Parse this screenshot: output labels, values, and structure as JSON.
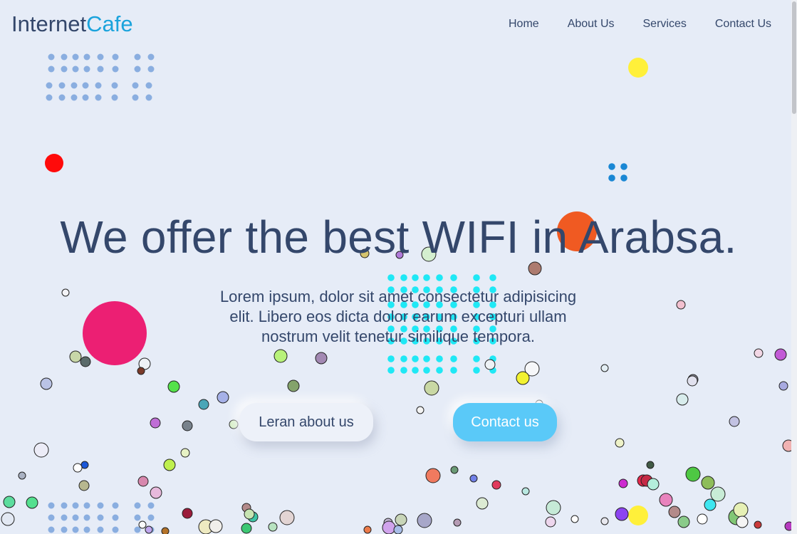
{
  "brand": {
    "part1": "Internet",
    "part2": "Cafe"
  },
  "nav": {
    "items": [
      "Home",
      "About Us",
      "Services",
      "Contact Us"
    ]
  },
  "hero": {
    "title": "We offer the best WIFI in Arabsa.",
    "text": "Lorem ipsum, dolor sit amet consectetur adipisicing elit. Libero eos dicta dolor earum excepturi ullam nostrum velit tenetur similique tempora.",
    "btn_learn": "Leran about us",
    "btn_contact": "Contact us"
  },
  "colors": {
    "background": "#e6ecf7",
    "text": "#34476b",
    "accent": "#1aa3dc",
    "contact_button": "#5ac9f8"
  }
}
